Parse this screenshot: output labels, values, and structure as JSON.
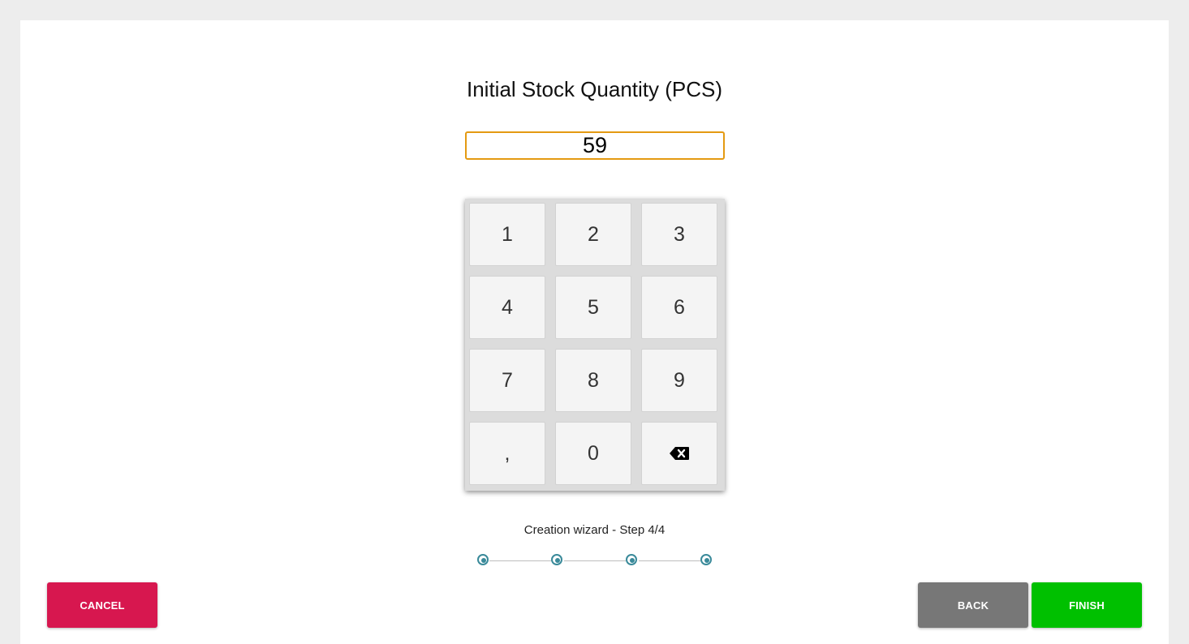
{
  "title": "Initial Stock Quantity (PCS)",
  "quantity": {
    "value": "59"
  },
  "keypad": {
    "keys": [
      "1",
      "2",
      "3",
      "4",
      "5",
      "6",
      "7",
      "8",
      "9",
      ",",
      "0"
    ],
    "backspace_icon": "backspace-icon"
  },
  "wizard": {
    "label": "Creation wizard - Step 4/4",
    "current_step": 4,
    "total_steps": 4
  },
  "buttons": {
    "cancel": "CANCEL",
    "back": "BACK",
    "finish": "FINISH"
  },
  "colors": {
    "cancel": "#d7174f",
    "back": "#777777",
    "finish": "#00c000",
    "input_border": "#e49a12",
    "step_accent": "#3a8a9a"
  }
}
